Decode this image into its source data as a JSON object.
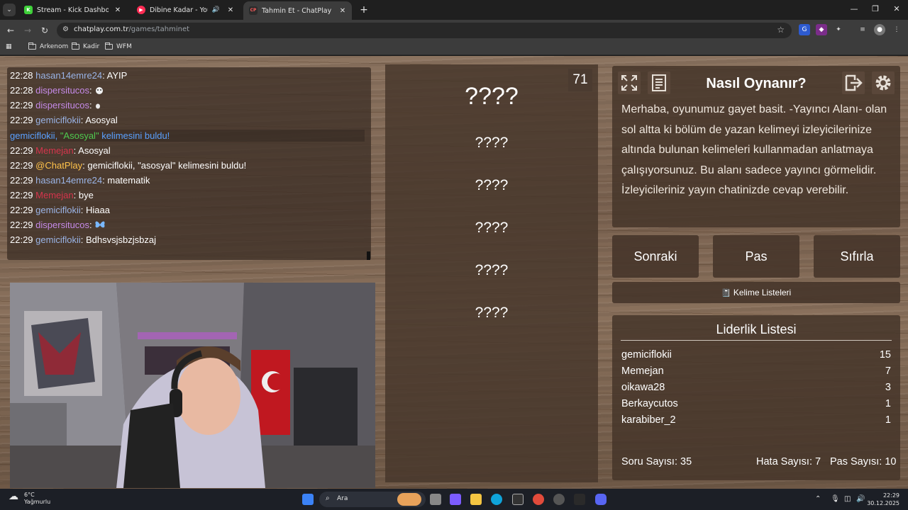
{
  "browser": {
    "tabs": [
      {
        "title": "Stream - Kick Dashboard",
        "favicon": "K",
        "favicon_color": "#3fd13a"
      },
      {
        "title": "Dibine Kadar - YouTube Mu",
        "favicon": "▶",
        "favicon_color": "#ff2d55"
      },
      {
        "title": "Tahmin Et - ChatPlay",
        "favicon": "CP",
        "favicon_color": "#2b2b2b"
      }
    ],
    "url_host": "chatplay.com.tr",
    "url_path": "/games/tahminet",
    "bookmarks": [
      "Arkenom",
      "Kadir",
      "WFM"
    ]
  },
  "chat": [
    {
      "time": "22:28",
      "user": "hasan14emre24",
      "color": "blue",
      "msg": "AYIP"
    },
    {
      "time": "22:28",
      "user": "dispersitucos",
      "color": "purple",
      "msg": "",
      "emote": "emote"
    },
    {
      "time": "22:29",
      "user": "dispersitucos",
      "color": "purple",
      "msg": "",
      "emote": "emote-small"
    },
    {
      "time": "22:29",
      "user": "gemiciflokii",
      "color": "blue",
      "msg": "Asosyal"
    },
    {
      "time": "22:29",
      "user": "Memejan",
      "color": "red",
      "msg": "Asosyal"
    },
    {
      "time": "22:29",
      "user": "@ChatPlay",
      "color": "orange",
      "msg": "gemiciflokii, \"asosyal\" kelimesini buldu!"
    },
    {
      "time": "22:29",
      "user": "hasan14emre24",
      "color": "blue",
      "msg": "matematik"
    },
    {
      "time": "22:29",
      "user": "Memejan",
      "color": "red",
      "msg": "bye"
    },
    {
      "time": "22:29",
      "user": "gemiciflokii",
      "color": "blue",
      "msg": "Hiaaa"
    },
    {
      "time": "22:29",
      "user": "dispersitucos",
      "color": "purple",
      "msg": "",
      "emote": "butterfly"
    },
    {
      "time": "22:29",
      "user": "gemiciflokii",
      "color": "blue",
      "msg": "Bdhsvsjsbzjsbzaj"
    }
  ],
  "chat_notice": {
    "user": "gemiciflokii,",
    "word": "\"Asosyal\"",
    "rest": "kelimesini buldu!"
  },
  "game": {
    "counter": "71",
    "hidden_words": [
      "????",
      "????",
      "????",
      "????",
      "????",
      "????"
    ]
  },
  "howto": {
    "title": "Nasıl Oynanır?",
    "text": "Merhaba, oyunumuz gayet basit. -Yayıncı Alanı- olan sol altta ki bölüm de yazan kelimeyi izleyicilerinize altında bulunan kelimeleri kullanmadan anlatmaya çalışıyorsunuz. Bu alanı sadece yayıncı görmelidir. İzleyicileriniz yayın chatinizde cevap verebilir."
  },
  "buttons": {
    "next": "Sonraki",
    "pass": "Pas",
    "reset": "Sıfırla",
    "word_lists": "Kelime Listeleri"
  },
  "leaderboard": {
    "title": "Liderlik Listesi",
    "rows": [
      {
        "name": "gemiciflokii",
        "score": "15"
      },
      {
        "name": "Memejan",
        "score": "7"
      },
      {
        "name": "oikawa28",
        "score": "3"
      },
      {
        "name": "Berkaycutos",
        "score": "1"
      },
      {
        "name": "karabiber_2",
        "score": "1"
      }
    ],
    "questions": "Soru Sayısı: 35",
    "errors": "Hata Sayısı: 7",
    "passes": "Pas Sayısı: 10"
  },
  "taskbar": {
    "weather_temp": "6°C",
    "weather_text": "Yağmurlu",
    "search": "Ara",
    "time": "22:29",
    "date": "30.12.2025"
  }
}
